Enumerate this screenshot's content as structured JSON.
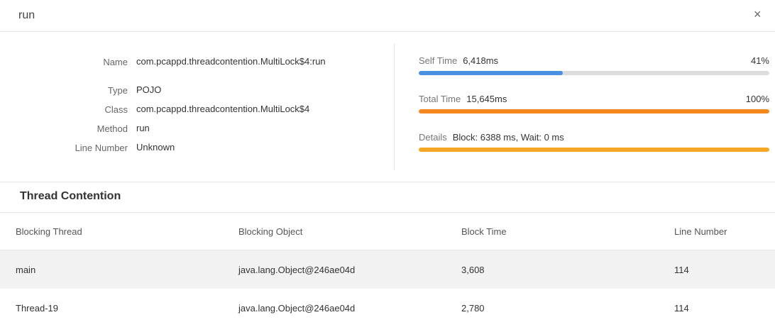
{
  "dialog": {
    "title": "run",
    "close_symbol": "×"
  },
  "properties": [
    {
      "label": "Name",
      "value": "com.pcappd.threadcontention.MultiLock$4:run"
    },
    {
      "label": "Type",
      "value": "POJO"
    },
    {
      "label": "Class",
      "value": "com.pcappd.threadcontention.MultiLock$4"
    },
    {
      "label": "Method",
      "value": "run"
    },
    {
      "label": "Line Number",
      "value": "Unknown"
    }
  ],
  "metrics": {
    "self_time": {
      "label": "Self Time",
      "value": "6,418ms",
      "percent": "41%",
      "fraction": 0.41,
      "color": "#4a90e2"
    },
    "total_time": {
      "label": "Total Time",
      "value": "15,645ms",
      "percent": "100%",
      "fraction": 1.0,
      "color": "#f5871f"
    },
    "details": {
      "label": "Details",
      "value": "Block: 6388 ms, Wait: 0 ms",
      "fraction": 1.0,
      "color": "#f5a623"
    }
  },
  "contention": {
    "title": "Thread Contention",
    "columns": [
      "Blocking Thread",
      "Blocking Object",
      "Block Time",
      "Line Number"
    ],
    "rows": [
      [
        "main",
        "java.lang.Object@246ae04d",
        "3,608",
        "114"
      ],
      [
        "Thread-19",
        "java.lang.Object@246ae04d",
        "2,780",
        "114"
      ]
    ]
  }
}
